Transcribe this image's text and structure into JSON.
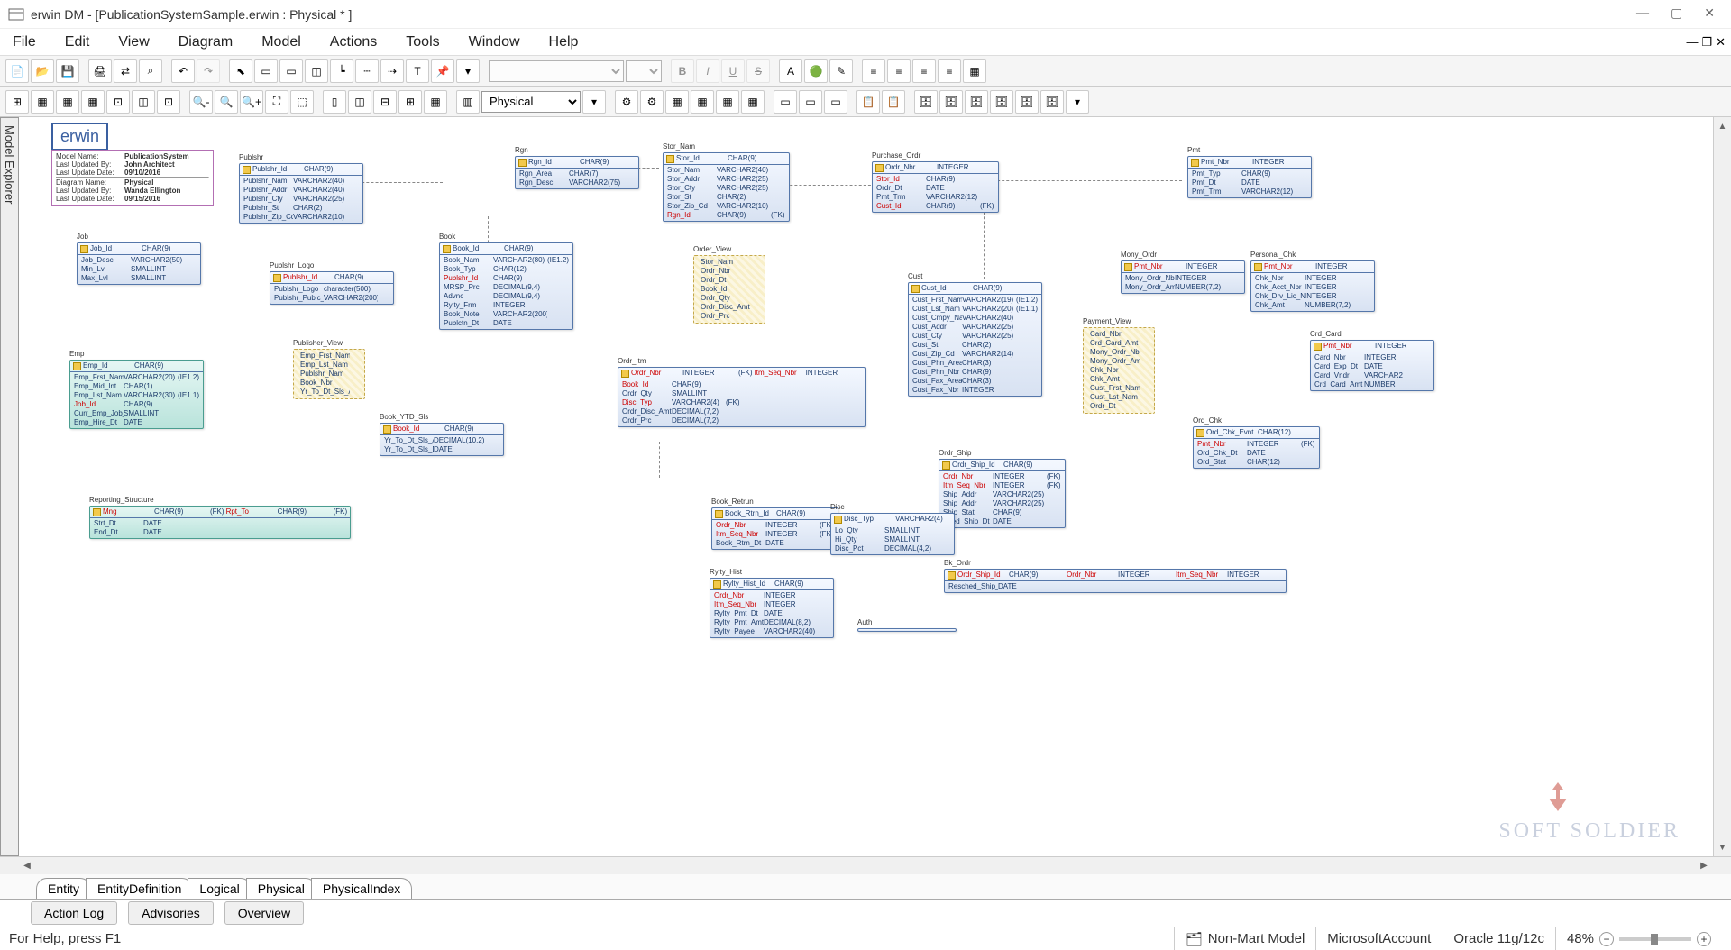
{
  "title": "erwin DM  -  [PublicationSystemSample.erwin : Physical * ]",
  "menubar": [
    "File",
    "Edit",
    "View",
    "Diagram",
    "Model",
    "Actions",
    "Tools",
    "Window",
    "Help"
  ],
  "viewSelect": "Physical",
  "sidetab": "Model Explorer",
  "meta": {
    "rows": [
      [
        "Model Name:",
        "PublicationSystem"
      ],
      [
        "Last Updated By:",
        "John Architect"
      ],
      [
        "Last Update Date:",
        "09/10/2016"
      ],
      [
        "Diagram Name:",
        "Physical"
      ],
      [
        "Last Updated By:",
        "Wanda Ellington"
      ],
      [
        "Last Update Date:",
        "09/15/2016"
      ]
    ]
  },
  "logo": "erwin",
  "entities": {
    "publshr": {
      "title": "Publshr",
      "pk": [
        [
          "Publshr_Id",
          "CHAR(9)"
        ]
      ],
      "cols": [
        [
          "Publshr_Nam",
          "VARCHAR2(40)"
        ],
        [
          "Publshr_Addr",
          "VARCHAR2(40)"
        ],
        [
          "Publshr_Cty",
          "VARCHAR2(25)"
        ],
        [
          "Publshr_St",
          "CHAR(2)"
        ],
        [
          "Publshr_Zip_Cd",
          "VARCHAR2(10)"
        ]
      ]
    },
    "rgn": {
      "title": "Rgn",
      "pk": [
        [
          "Rgn_Id",
          "CHAR(9)"
        ]
      ],
      "cols": [
        [
          "Rgn_Area",
          "CHAR(7)"
        ],
        [
          "Rgn_Desc",
          "VARCHAR2(75)"
        ]
      ]
    },
    "stor": {
      "title": "Stor_Nam",
      "pk": [
        [
          "Stor_Id",
          "CHAR(9)"
        ]
      ],
      "cols": [
        [
          "Stor_Nam",
          "VARCHAR2(40)"
        ],
        [
          "Stor_Addr",
          "VARCHAR2(25)"
        ],
        [
          "Stor_Cty",
          "VARCHAR2(25)"
        ],
        [
          "Stor_St",
          "CHAR(2)"
        ],
        [
          "Stor_Zip_Cd",
          "VARCHAR2(10)"
        ],
        [
          "Rgn_Id",
          "CHAR(9)",
          "(FK)",
          "red"
        ]
      ]
    },
    "purchase": {
      "title": "Purchase_Ordr",
      "pk": [
        [
          "Ordr_Nbr",
          "INTEGER"
        ]
      ],
      "cols": [
        [
          "Stor_Id",
          "CHAR(9)",
          "",
          "red"
        ],
        [
          "Ordr_Dt",
          "DATE"
        ],
        [
          "Pmt_Trm",
          "VARCHAR2(12)"
        ],
        [
          "Cust_Id",
          "CHAR(9)",
          "(FK)",
          "red"
        ]
      ]
    },
    "pmt": {
      "title": "Pmt",
      "pk": [
        [
          "Pmt_Nbr",
          "INTEGER"
        ]
      ],
      "cols": [
        [
          "Pmt_Typ",
          "CHAR(9)"
        ],
        [
          "Pmt_Dt",
          "DATE"
        ],
        [
          "Pmt_Trm",
          "VARCHAR2(12)"
        ]
      ]
    },
    "job": {
      "title": "Job",
      "pk": [
        [
          "Job_Id",
          "CHAR(9)"
        ]
      ],
      "cols": [
        [
          "Job_Desc",
          "VARCHAR2(50)"
        ],
        [
          "Min_Lvl",
          "SMALLINT"
        ],
        [
          "Max_Lvl",
          "SMALLINT"
        ]
      ]
    },
    "publogo": {
      "title": "Publshr_Logo",
      "pk": [
        [
          "Publshr_Id",
          "CHAR(9)",
          "",
          "red"
        ]
      ],
      "cols": [
        [
          "Publshr_Logo",
          "character(500)"
        ],
        [
          "Publshr_Publc_Rel_Inf",
          "VARCHAR2(200)"
        ]
      ]
    },
    "book": {
      "title": "Book",
      "pk": [
        [
          "Book_Id",
          "CHAR(9)"
        ]
      ],
      "cols": [
        [
          "Book_Nam",
          "VARCHAR2(80)",
          "(IE1.2)"
        ],
        [
          "Book_Typ",
          "CHAR(12)"
        ],
        [
          "Publshr_Id",
          "CHAR(9)",
          "",
          "red"
        ],
        [
          "MRSP_Prc",
          "DECIMAL(9,4)"
        ],
        [
          "Advnc",
          "DECIMAL(9,4)"
        ],
        [
          "Rylty_Frm",
          "INTEGER"
        ],
        [
          "Book_Note",
          "VARCHAR2(200)"
        ],
        [
          "Publctn_Dt",
          "DATE"
        ]
      ]
    },
    "orderview": {
      "title": "Order_View",
      "view": true,
      "cols": [
        [
          "Stor_Nam"
        ],
        [
          "Ordr_Nbr"
        ],
        [
          "Ordr_Dt"
        ],
        [
          "Book_Id"
        ],
        [
          "Ordr_Qty"
        ],
        [
          "Ordr_Disc_Amt"
        ],
        [
          "Ordr_Prc"
        ]
      ]
    },
    "cust": {
      "title": "Cust",
      "pk": [
        [
          "Cust_Id",
          "CHAR(9)"
        ]
      ],
      "cols": [
        [
          "Cust_Frst_Nam",
          "VARCHAR2(19)",
          "(IE1.2)"
        ],
        [
          "Cust_Lst_Nam",
          "VARCHAR2(20)",
          "(IE1.1)"
        ],
        [
          "Cust_Cmpy_Nam",
          "VARCHAR2(40)"
        ],
        [
          "Cust_Addr",
          "VARCHAR2(25)"
        ],
        [
          "Cust_Cty",
          "VARCHAR2(25)"
        ],
        [
          "Cust_St",
          "CHAR(2)"
        ],
        [
          "Cust_Zip_Cd",
          "VARCHAR2(14)"
        ],
        [
          "Cust_Phn_Area_Cd",
          "CHAR(3)"
        ],
        [
          "Cust_Phn_Nbr",
          "CHAR(9)"
        ],
        [
          "Cust_Fax_Area_Cd",
          "CHAR(3)"
        ],
        [
          "Cust_Fax_Nbr",
          "INTEGER"
        ]
      ]
    },
    "money": {
      "title": "Mony_Ordr",
      "pk": [
        [
          "Pmt_Nbr",
          "INTEGER",
          "",
          "red"
        ]
      ],
      "cols": [
        [
          "Mony_Ordr_Nbr",
          "INTEGER"
        ],
        [
          "Mony_Ordr_Amt",
          "NUMBER(7,2)"
        ]
      ]
    },
    "personal": {
      "title": "Personal_Chk",
      "pk": [
        [
          "Pmt_Nbr",
          "INTEGER",
          "",
          "red"
        ]
      ],
      "cols": [
        [
          "Chk_Nbr",
          "INTEGER"
        ],
        [
          "Chk_Acct_Nbr",
          "INTEGER"
        ],
        [
          "Chk_Drv_Lic_Nbr",
          "INTEGER"
        ],
        [
          "Chk_Amt",
          "NUMBER(7,2)"
        ]
      ]
    },
    "pubview": {
      "title": "Publisher_View",
      "view": true,
      "cols": [
        [
          "Emp_Frst_Nam"
        ],
        [
          "Emp_Lst_Nam"
        ],
        [
          "Publshr_Nam"
        ],
        [
          "Book_Nbr"
        ],
        [
          "Yr_To_Dt_Sls_Amt"
        ]
      ]
    },
    "pmtview": {
      "title": "Payment_View",
      "view": true,
      "cols": [
        [
          "Card_Nbr"
        ],
        [
          "Crd_Card_Amt"
        ],
        [
          "Mony_Ordr_Nbr"
        ],
        [
          "Mony_Ordr_Amt"
        ],
        [
          "Chk_Nbr"
        ],
        [
          "Chk_Amt"
        ],
        [
          "Cust_Frst_Nam"
        ],
        [
          "Cust_Lst_Nam"
        ],
        [
          "Ordr_Dt"
        ]
      ]
    },
    "crdcard": {
      "title": "Crd_Card",
      "pk": [
        [
          "Pmt_Nbr",
          "INTEGER",
          "",
          "red"
        ]
      ],
      "cols": [
        [
          "Card_Nbr",
          "INTEGER"
        ],
        [
          "Card_Exp_Dt",
          "DATE"
        ],
        [
          "Card_Vndr",
          "VARCHAR2"
        ],
        [
          "Crd_Card_Amt",
          "NUMBER"
        ]
      ]
    },
    "emp": {
      "title": "Emp",
      "pk": [
        [
          "Emp_Id",
          "CHAR(9)"
        ]
      ],
      "cols": [
        [
          "Emp_Frst_Nam",
          "VARCHAR2(20)",
          "(IE1.2)"
        ],
        [
          "Emp_Mid_Int",
          "CHAR(1)"
        ],
        [
          "Emp_Lst_Nam",
          "VARCHAR2(30)",
          "(IE1.1)"
        ],
        [
          "Job_Id",
          "CHAR(9)",
          "",
          "red"
        ],
        [
          "Curr_Emp_Job_Yrs",
          "SMALLINT"
        ],
        [
          "Emp_Hire_Dt",
          "DATE"
        ]
      ],
      "teal": true
    },
    "bookytd": {
      "title": "Book_YTD_Sls",
      "pk": [
        [
          "Book_Id",
          "CHAR(9)",
          "",
          "red"
        ]
      ],
      "cols": [
        [
          "Yr_To_Dt_Sls_Amt",
          "DECIMAL(10,2)"
        ],
        [
          "Yr_To_Dt_Sls_Dt",
          "DATE"
        ]
      ]
    },
    "ordritm": {
      "title": "Ordr_Itm",
      "pk": [
        [
          "Ordr_Nbr",
          "INTEGER",
          "(FK)",
          "red"
        ],
        [
          "Itm_Seq_Nbr",
          "INTEGER"
        ]
      ],
      "cols": [
        [
          "Book_Id",
          "CHAR(9)",
          "",
          "red"
        ],
        [
          "Ordr_Qty",
          "SMALLINT"
        ],
        [
          "Disc_Typ",
          "VARCHAR2(4)",
          "(FK)",
          "red"
        ],
        [
          "Ordr_Disc_Amt",
          "DECIMAL(7,2)"
        ],
        [
          "Ordr_Prc",
          "DECIMAL(7,2)"
        ]
      ]
    },
    "ordrship": {
      "title": "Ordr_Ship",
      "pk": [
        [
          "Ordr_Ship_Id",
          "CHAR(9)"
        ]
      ],
      "cols": [
        [
          "Ordr_Nbr",
          "INTEGER",
          "(FK)",
          "red"
        ],
        [
          "Itm_Seq_Nbr",
          "INTEGER",
          "(FK)",
          "red"
        ],
        [
          "Ship_Addr",
          "VARCHAR2(25)"
        ],
        [
          "Ship_Addr",
          "VARCHAR2(25)"
        ],
        [
          "Ship_Stat",
          "CHAR(9)"
        ],
        [
          "Shed_Ship_Dt",
          "DATE"
        ]
      ]
    },
    "ordchk": {
      "title": "Ord_Chk",
      "pk": [
        [
          "Ord_Chk_Evnt",
          "CHAR(12)"
        ]
      ],
      "cols": [
        [
          "Pmt_Nbr",
          "INTEGER",
          "(FK)",
          "red"
        ],
        [
          "Ord_Chk_Dt",
          "DATE"
        ],
        [
          "Ord_Stat",
          "CHAR(12)"
        ]
      ]
    },
    "rpt": {
      "title": "Reporting_Structure",
      "pk": [
        [
          "Mng",
          "CHAR(9)",
          "(FK)",
          "red"
        ],
        [
          "Rpt_To",
          "CHAR(9)",
          "(FK)",
          "red"
        ]
      ],
      "cols": [
        [
          "Strt_Dt",
          "DATE"
        ],
        [
          "End_Dt",
          "DATE"
        ]
      ],
      "teal": true
    },
    "bookrtrn": {
      "title": "Book_Retrun",
      "pk": [
        [
          "Book_Rtrn_Id",
          "CHAR(9)"
        ]
      ],
      "cols": [
        [
          "Ordr_Nbr",
          "INTEGER",
          "(FK)",
          "red"
        ],
        [
          "Itm_Seq_Nbr",
          "INTEGER",
          "(FK)",
          "red"
        ],
        [
          "Book_Rtrn_Dt",
          "DATE"
        ]
      ]
    },
    "disc": {
      "title": "Disc",
      "pk": [
        [
          "Disc_Typ",
          "VARCHAR2(4)"
        ]
      ],
      "cols": [
        [
          "Lo_Qty",
          "SMALLINT"
        ],
        [
          "Hi_Qty",
          "SMALLINT"
        ],
        [
          "Disc_Pct",
          "DECIMAL(4,2)"
        ]
      ]
    },
    "bkordr": {
      "title": "Bk_Ordr",
      "pk": [
        [
          "Ordr_Ship_Id",
          "CHAR(9)",
          "",
          "red"
        ],
        [
          "Ordr_Nbr",
          "INTEGER",
          "",
          "red"
        ],
        [
          "Itm_Seq_Nbr",
          "INTEGER",
          "",
          "red"
        ]
      ],
      "cols": [
        [
          "Resched_Ship_Dt",
          "DATE"
        ]
      ]
    },
    "rylty": {
      "title": "Rylty_Hist",
      "pk": [
        [
          "Rylty_Hist_Id",
          "CHAR(9)"
        ]
      ],
      "cols": [
        [
          "Ordr_Nbr",
          "INTEGER",
          "",
          "red"
        ],
        [
          "Itm_Seq_Nbr",
          "INTEGER",
          "",
          "red"
        ],
        [
          "Rylty_Pmt_Dt",
          "DATE"
        ],
        [
          "Rylty_Pmt_Amt",
          "DECIMAL(8,2)"
        ],
        [
          "Rylty_Payee",
          "VARCHAR2(40)"
        ]
      ]
    },
    "auth": {
      "title": "Auth"
    }
  },
  "bottabs": [
    "Entity",
    "EntityDefinition",
    "Logical",
    "Physical",
    "PhysicalIndex"
  ],
  "bottab_selected": 3,
  "subtabs": [
    "Action Log",
    "Advisories",
    "Overview"
  ],
  "status": {
    "help": "For Help, press F1",
    "model": "Non-Mart Model",
    "account": "MicrosoftAccount",
    "db": "Oracle 11g/12c",
    "zoom": "48%"
  },
  "watermark": "SOFT SOLDIER"
}
